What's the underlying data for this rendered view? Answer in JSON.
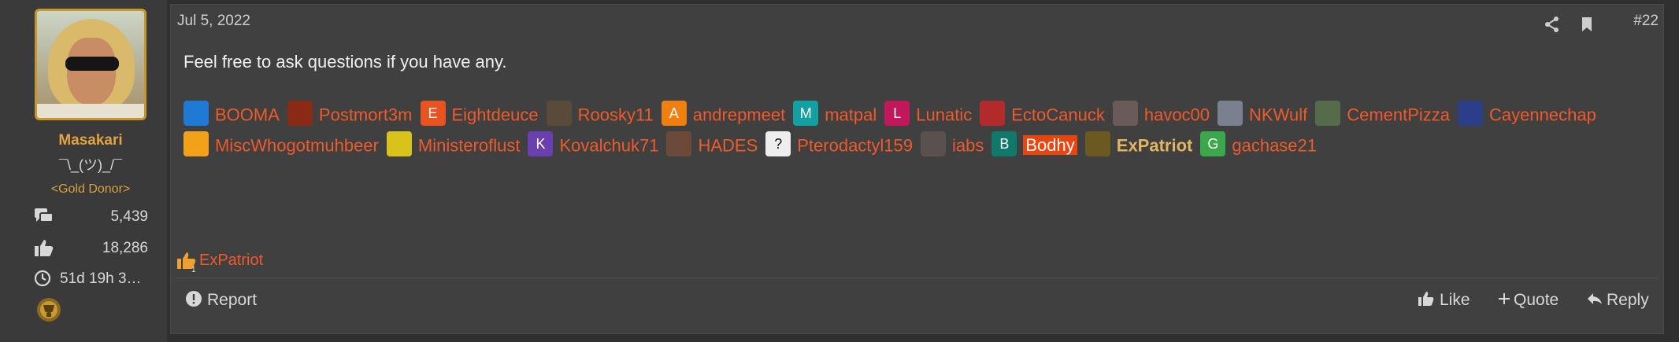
{
  "user": {
    "name": "Masakari",
    "title": "¯\\_(ツ)_/¯",
    "banner": "<Gold Donor>",
    "messages": "5,439",
    "reactions": "18,286",
    "time": "51d 19h 3…"
  },
  "post": {
    "date": "Jul 5, 2022",
    "number": "#22",
    "message": "Feel free to ask questions if you have any.",
    "mentions": [
      {
        "name": "BOOMA",
        "letter": "",
        "color": "#1f7ad6"
      },
      {
        "name": "Postmort3m",
        "letter": "",
        "color": "#8a2a14"
      },
      {
        "name": "Eightdeuce",
        "letter": "E",
        "color": "#e8541f"
      },
      {
        "name": "Roosky11",
        "letter": "",
        "color": "#5a4a3a"
      },
      {
        "name": "andrepmeet",
        "letter": "A",
        "color": "#f07f10"
      },
      {
        "name": "matpal",
        "letter": "M",
        "color": "#12a0a3"
      },
      {
        "name": "Lunatic",
        "letter": "L",
        "color": "#c2185b"
      },
      {
        "name": "EctoCanuck",
        "letter": "",
        "color": "#b22a2a"
      },
      {
        "name": "havoc00",
        "letter": "",
        "color": "#6b5a5a"
      },
      {
        "name": "NKWulf",
        "letter": "",
        "color": "#7a8090"
      },
      {
        "name": "CementPizza",
        "letter": "",
        "color": "#556b4a"
      },
      {
        "name": "Cayennechap",
        "letter": "",
        "color": "#2c3e8a"
      },
      {
        "name": "MiscWhogotmuhbeer",
        "letter": "",
        "color": "#f4a11a"
      },
      {
        "name": "Ministeroflust",
        "letter": "",
        "color": "#d9c21a"
      },
      {
        "name": "Kovalchuk71",
        "letter": "K",
        "color": "#6a3fb0"
      },
      {
        "name": "HADES",
        "letter": "",
        "color": "#6b4a3a"
      },
      {
        "name": "Pterodactyl159",
        "letter": "?",
        "color": "#eeeeee"
      },
      {
        "name": "iabs",
        "letter": "",
        "color": "#5a5050"
      },
      {
        "name": "Bodhy",
        "letter": "B",
        "color": "#0f7a6a"
      },
      {
        "name": "ExPatriot",
        "letter": "",
        "color": "#6a5a20"
      },
      {
        "name": "gachase21",
        "letter": "G",
        "color": "#3aa84a"
      }
    ],
    "reaction_user": "ExPatriot",
    "reaction_count": "1"
  },
  "footer": {
    "report": "Report",
    "like": "Like",
    "quote": "Quote",
    "reply": "Reply"
  },
  "colors": {
    "accent": "#ef5a2a",
    "gold": "#e3a33e",
    "panel": "#404040",
    "background": "#303030"
  },
  "icons": [
    "messages-icon",
    "thumbs-up-icon",
    "clock-icon",
    "trophy-icon",
    "share-icon",
    "bookmark-icon",
    "report-icon",
    "like-icon",
    "quote-icon",
    "reply-icon"
  ]
}
